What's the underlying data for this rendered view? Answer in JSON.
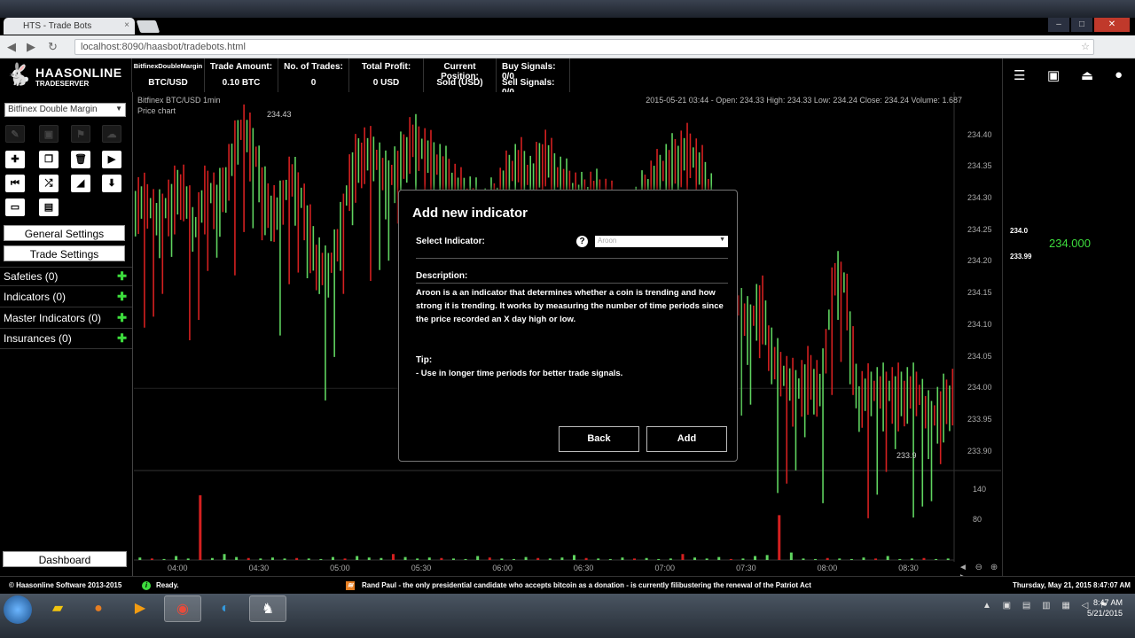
{
  "browser": {
    "tab_title": "HTS - Trade Bots",
    "tab_close": "×",
    "url": "localhost:8090/haasbot/tradebots.html",
    "win_minimize": "–",
    "win_maximize": "□",
    "win_close": "✕"
  },
  "header": {
    "logo_name": "HAASONLINE",
    "logo_sub": "TRADESERVER",
    "stats": [
      {
        "label": "BitfinexDoubleMargin",
        "value": "BTC/USD"
      },
      {
        "label": "Trade Amount:",
        "value": "0.10 BTC"
      },
      {
        "label": "No. of Trades:",
        "value": "0"
      },
      {
        "label": "Total Profit:",
        "value": "0 USD"
      },
      {
        "label": "Current Position:",
        "value": "Sold (USD)"
      },
      {
        "label": "Buy Signals: 0/0",
        "value": "Sell Signals: 0/0"
      }
    ]
  },
  "sidebar": {
    "exchange": "Bitfinex Double Margin",
    "general_settings": "General Settings",
    "trade_settings": "Trade Settings",
    "items": [
      {
        "label": "Safeties (0)"
      },
      {
        "label": "Indicators (0)"
      },
      {
        "label": "Master Indicators (0)"
      },
      {
        "label": "Insurances (0)"
      }
    ],
    "plus": "✚",
    "dashboard": "Dashboard"
  },
  "chart": {
    "title": "Bitfinex BTC/USD 1min",
    "subtitle": "Price chart",
    "ohlc_info": "2015-05-21 03:44 - Open: 234.33 High: 234.33 Low: 234.24 Close: 234.24 Volume: 1.687",
    "high_label": "234.43",
    "low_label": "233.9",
    "zoom_controls": "◄ ⊖ ⊕ ►"
  },
  "chart_data": {
    "type": "bar",
    "y_ticks": [
      "234.40",
      "234.35",
      "234.30",
      "234.25",
      "234.20",
      "234.15",
      "234.10",
      "234.05",
      "234.00",
      "233.95",
      "233.90"
    ],
    "ylim": [
      233.88,
      234.44
    ],
    "volume_ticks": [
      "140",
      "80"
    ],
    "x_ticks": [
      "04:00",
      "04:30",
      "05:00",
      "05:30",
      "06:00",
      "06:30",
      "07:00",
      "07:30",
      "08:00",
      "08:30"
    ],
    "annotations": [
      "234.43",
      "233.9"
    ],
    "series": [
      {
        "name": "up",
        "color": "#5fd35f"
      },
      {
        "name": "down",
        "color": "#d42020"
      }
    ],
    "price_path": [
      234.3,
      234.27,
      234.3,
      234.33,
      234.25,
      234.32,
      234.3,
      234.36,
      234.42,
      234.38,
      234.3,
      234.28,
      234.34,
      234.3,
      234.22,
      234.18,
      234.24,
      234.35,
      234.38,
      234.37,
      234.33,
      234.36,
      234.4,
      234.38,
      234.36,
      234.34,
      234.31,
      234.3,
      234.28,
      234.3,
      234.34,
      234.36,
      234.33,
      234.38,
      234.34,
      234.32,
      234.3,
      234.31,
      234.3,
      234.28,
      234.26,
      234.3,
      234.33,
      234.35,
      234.37,
      234.38,
      234.35,
      234.3,
      234.22,
      234.14,
      234.1,
      234.15,
      234.05,
      234.02,
      234.0,
      234.03,
      234.0,
      234.18,
      234.17,
      233.99,
      234.0,
      234.0,
      234.0,
      234.0,
      234.0,
      233.95,
      233.98,
      234.0
    ],
    "volume_values": [
      5,
      3,
      2,
      8,
      3,
      130,
      4,
      12,
      6,
      4,
      3,
      5,
      3,
      4,
      3,
      2,
      6,
      3,
      8,
      5,
      4,
      12,
      6,
      3,
      5,
      4,
      3,
      2,
      8,
      5,
      3,
      2,
      6,
      4,
      3,
      5,
      10,
      4,
      3,
      2,
      5,
      3,
      4,
      2,
      3,
      12,
      5,
      3,
      6,
      2,
      3,
      8,
      10,
      90,
      15,
      3,
      2,
      4,
      3,
      2,
      5,
      3,
      8,
      2,
      3,
      4,
      2,
      3
    ]
  },
  "right_panel": {
    "price_top": "234.0",
    "price_bottom": "233.99",
    "current_price": "234.000"
  },
  "dialog": {
    "title": "Add new indicator",
    "select_label": "Select Indicator:",
    "help": "?",
    "selected_indicator": "Aroon",
    "description_label": "Description:",
    "description": "Aroon is a an indicator that determines whether a coin is trending and how strong it is trending. It works by measuring the number of time periods since the price recorded an X day high or low.",
    "tip_label": "Tip:",
    "tip": "- Use in longer time periods for better trade signals.",
    "back": "Back",
    "add": "Add"
  },
  "status": {
    "copyright": "© Haasonline Software 2013-2015",
    "ready": "Ready.",
    "news": "Rand Paul - the only presidential candidate who accepts bitcoin as a donation - is currently filibustering the renewal of the Patriot Act",
    "datetime": "Thursday, May 21, 2015 8:47:07 AM"
  },
  "taskbar": {
    "time": "8:47 AM",
    "date": "5/21/2015"
  }
}
